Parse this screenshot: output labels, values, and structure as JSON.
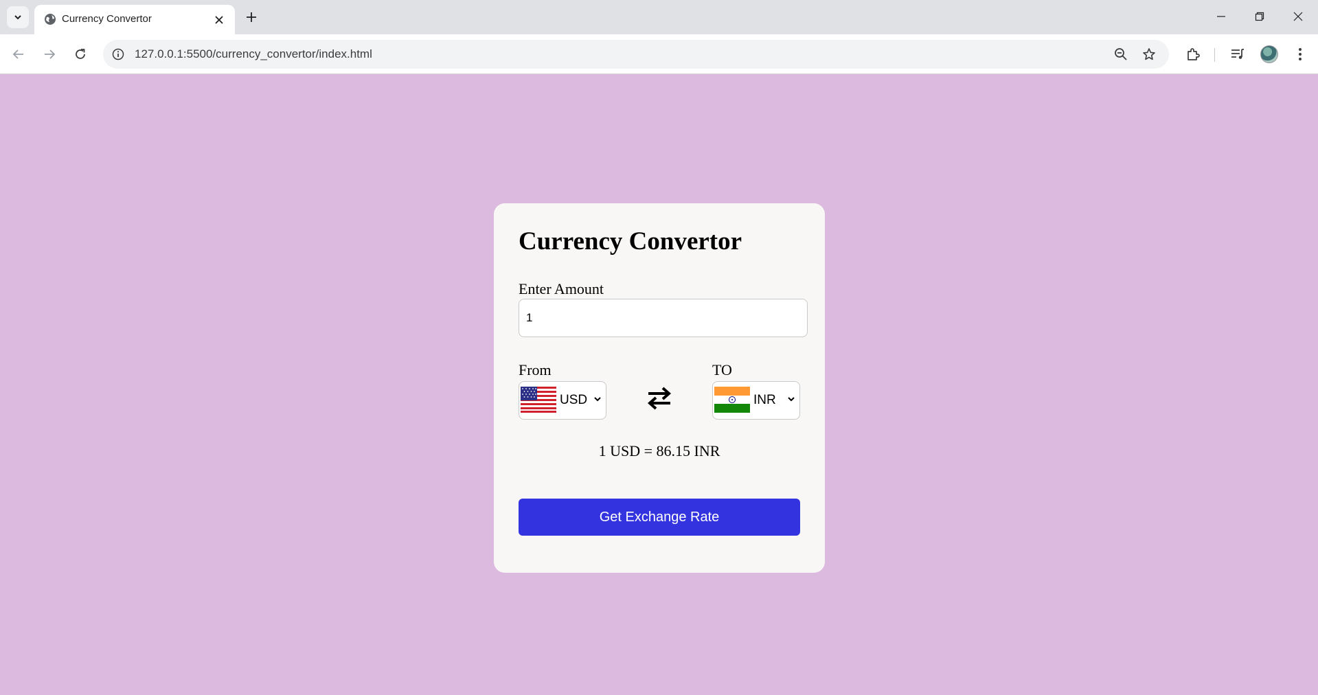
{
  "browser": {
    "tab_title": "Currency Convertor",
    "url": "127.0.0.1:5500/currency_convertor/index.html"
  },
  "app": {
    "title": "Currency Convertor",
    "amount_label": "Enter Amount",
    "amount_value": "1",
    "from_label": "From",
    "to_label": "TO",
    "from_currency": "USD",
    "to_currency": "INR",
    "rate_text": "1 USD = 86.15 INR",
    "button_label": "Get Exchange Rate"
  },
  "colors": {
    "page_background": "#dcbadf",
    "card_background": "#f9f7f5",
    "button": "#3333df"
  },
  "icons": {
    "tab_menu": "chevron-down-icon",
    "favicon": "globe-icon",
    "swap": "swap-arrows-icon"
  }
}
